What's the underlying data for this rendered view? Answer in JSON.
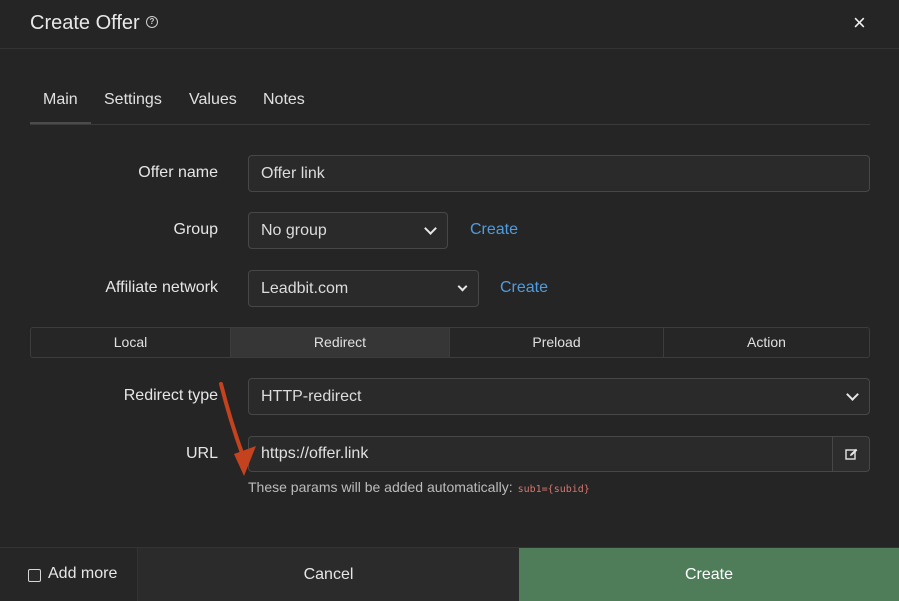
{
  "header": {
    "title": "Create Offer",
    "help_icon": "question-circle-icon",
    "close_icon": "×"
  },
  "tabs": [
    {
      "label": "Main",
      "active": true
    },
    {
      "label": "Settings",
      "active": false
    },
    {
      "label": "Values",
      "active": false
    },
    {
      "label": "Notes",
      "active": false
    }
  ],
  "form": {
    "offer_name": {
      "label": "Offer name",
      "value": "Offer link"
    },
    "group": {
      "label": "Group",
      "value": "No group",
      "create_label": "Create"
    },
    "affiliate_network": {
      "label": "Affiliate network",
      "value": "Leadbit.com",
      "create_label": "Create"
    },
    "mode_tabs": [
      {
        "label": "Local",
        "active": false
      },
      {
        "label": "Redirect",
        "active": true
      },
      {
        "label": "Preload",
        "active": false
      },
      {
        "label": "Action",
        "active": false
      }
    ],
    "redirect_type": {
      "label": "Redirect type",
      "value": "HTTP-redirect"
    },
    "url": {
      "label": "URL",
      "value": "https://offer.link",
      "edit_icon": "edit-icon"
    },
    "hint": {
      "text": "These params will be added automatically:",
      "code": "sub1={subid}"
    }
  },
  "footer": {
    "add_more_label": "Add more",
    "cancel_label": "Cancel",
    "create_label": "Create"
  },
  "colors": {
    "background": "#252525",
    "link": "#4f9ce0",
    "create_button": "#4f7d5a",
    "hint_code": "#d4776e",
    "annotation_arrow": "#c4421e"
  }
}
